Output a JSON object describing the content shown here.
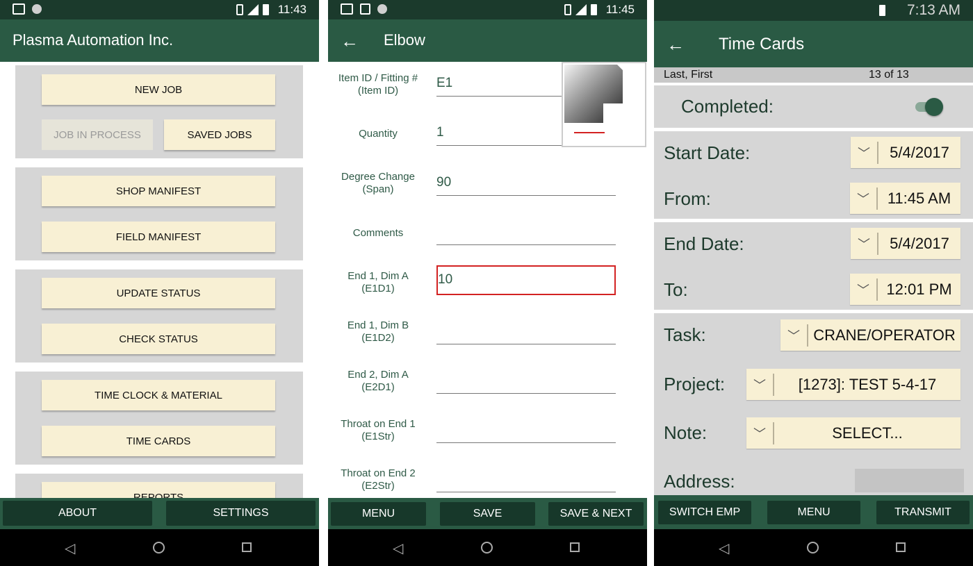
{
  "phone1": {
    "status_time": "11:43",
    "app_title": "Plasma Automation Inc.",
    "buttons": {
      "new_job": "NEW JOB",
      "job_in_process": "JOB IN PROCESS",
      "saved_jobs": "SAVED JOBS",
      "shop_manifest": "SHOP MANIFEST",
      "field_manifest": "FIELD MANIFEST",
      "update_status": "UPDATE STATUS",
      "check_status": "CHECK STATUS",
      "time_clock_material": "TIME CLOCK & MATERIAL",
      "time_cards": "TIME CARDS",
      "reports": "REPORTS"
    },
    "bottom": {
      "about": "ABOUT",
      "settings": "SETTINGS"
    }
  },
  "phone2": {
    "status_time": "11:45",
    "title": "Elbow",
    "fields": [
      {
        "label_line1": "Item ID / Fitting #",
        "label_line2": "(Item ID)",
        "value": "E1"
      },
      {
        "label_line1": "Quantity",
        "label_line2": "",
        "value": "1"
      },
      {
        "label_line1": "Degree Change",
        "label_line2": "(Span)",
        "value": "90"
      },
      {
        "label_line1": "Comments",
        "label_line2": "",
        "value": ""
      },
      {
        "label_line1": "End 1, Dim A",
        "label_line2": "(E1D1)",
        "value": "10"
      },
      {
        "label_line1": "End 1, Dim B",
        "label_line2": "(E1D2)",
        "value": ""
      },
      {
        "label_line1": "End 2, Dim A",
        "label_line2": "(E2D1)",
        "value": ""
      },
      {
        "label_line1": "Throat on End 1",
        "label_line2": "(E1Str)",
        "value": ""
      },
      {
        "label_line1": "Throat on End 2",
        "label_line2": "(E2Str)",
        "value": ""
      }
    ],
    "bottom": {
      "menu": "MENU",
      "save": "SAVE",
      "save_next": "SAVE & NEXT"
    }
  },
  "phone3": {
    "status_time": "7:13 AM",
    "title": "Time Cards",
    "employee": "Last, First",
    "record_count": "13 of 13",
    "completed_label": "Completed:",
    "completed_on": true,
    "start_date_label": "Start Date:",
    "start_date": "5/4/2017",
    "from_label": "From:",
    "from_time": "11:45 AM",
    "end_date_label": "End Date:",
    "end_date": "5/4/2017",
    "to_label": "To:",
    "to_time": "12:01 PM",
    "task_label": "Task:",
    "task": "CRANE/OPERATOR",
    "project_label": "Project:",
    "project": "[1273]: TEST 5-4-17",
    "note_label": "Note:",
    "note": "SELECT...",
    "address_label": "Address:",
    "bottom": {
      "switch_emp": "SWITCH EMP",
      "menu": "MENU",
      "transmit": "TRANSMIT"
    }
  },
  "colors": {
    "status_bar": "#1b3a2c",
    "app_bar": "#2a5a44",
    "button_fill": "#f8f0d4",
    "group_bg": "#d6d6d6",
    "error_border": "#d32222"
  }
}
